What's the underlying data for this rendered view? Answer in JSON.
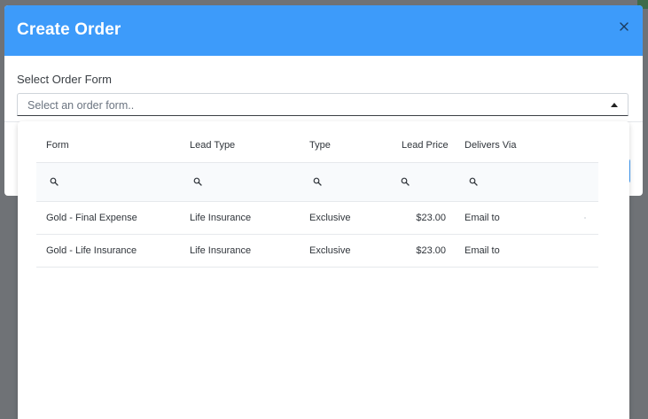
{
  "modal": {
    "title": "Create Order",
    "close_icon": "close-icon"
  },
  "form": {
    "label": "Select Order Form",
    "placeholder": "Select an order form..",
    "caret_icon": "caret-up-icon"
  },
  "dropdown": {
    "columns": [
      "Form",
      "Lead Type",
      "Type",
      "Lead Price",
      "Delivers Via"
    ],
    "filter_icon": "search-icon",
    "rows": [
      {
        "form": "Gold - Final Expense",
        "lead_type": "Life Insurance",
        "type": "Exclusive",
        "price": "$23.00",
        "delivers": "Email to"
      },
      {
        "form": "Gold - Life Insurance",
        "lead_type": "Life Insurance",
        "type": "Exclusive",
        "price": "$23.00",
        "delivers": "Email to"
      }
    ]
  },
  "colors": {
    "header": "#3d9bfa",
    "backdrop": "#6f7276"
  }
}
